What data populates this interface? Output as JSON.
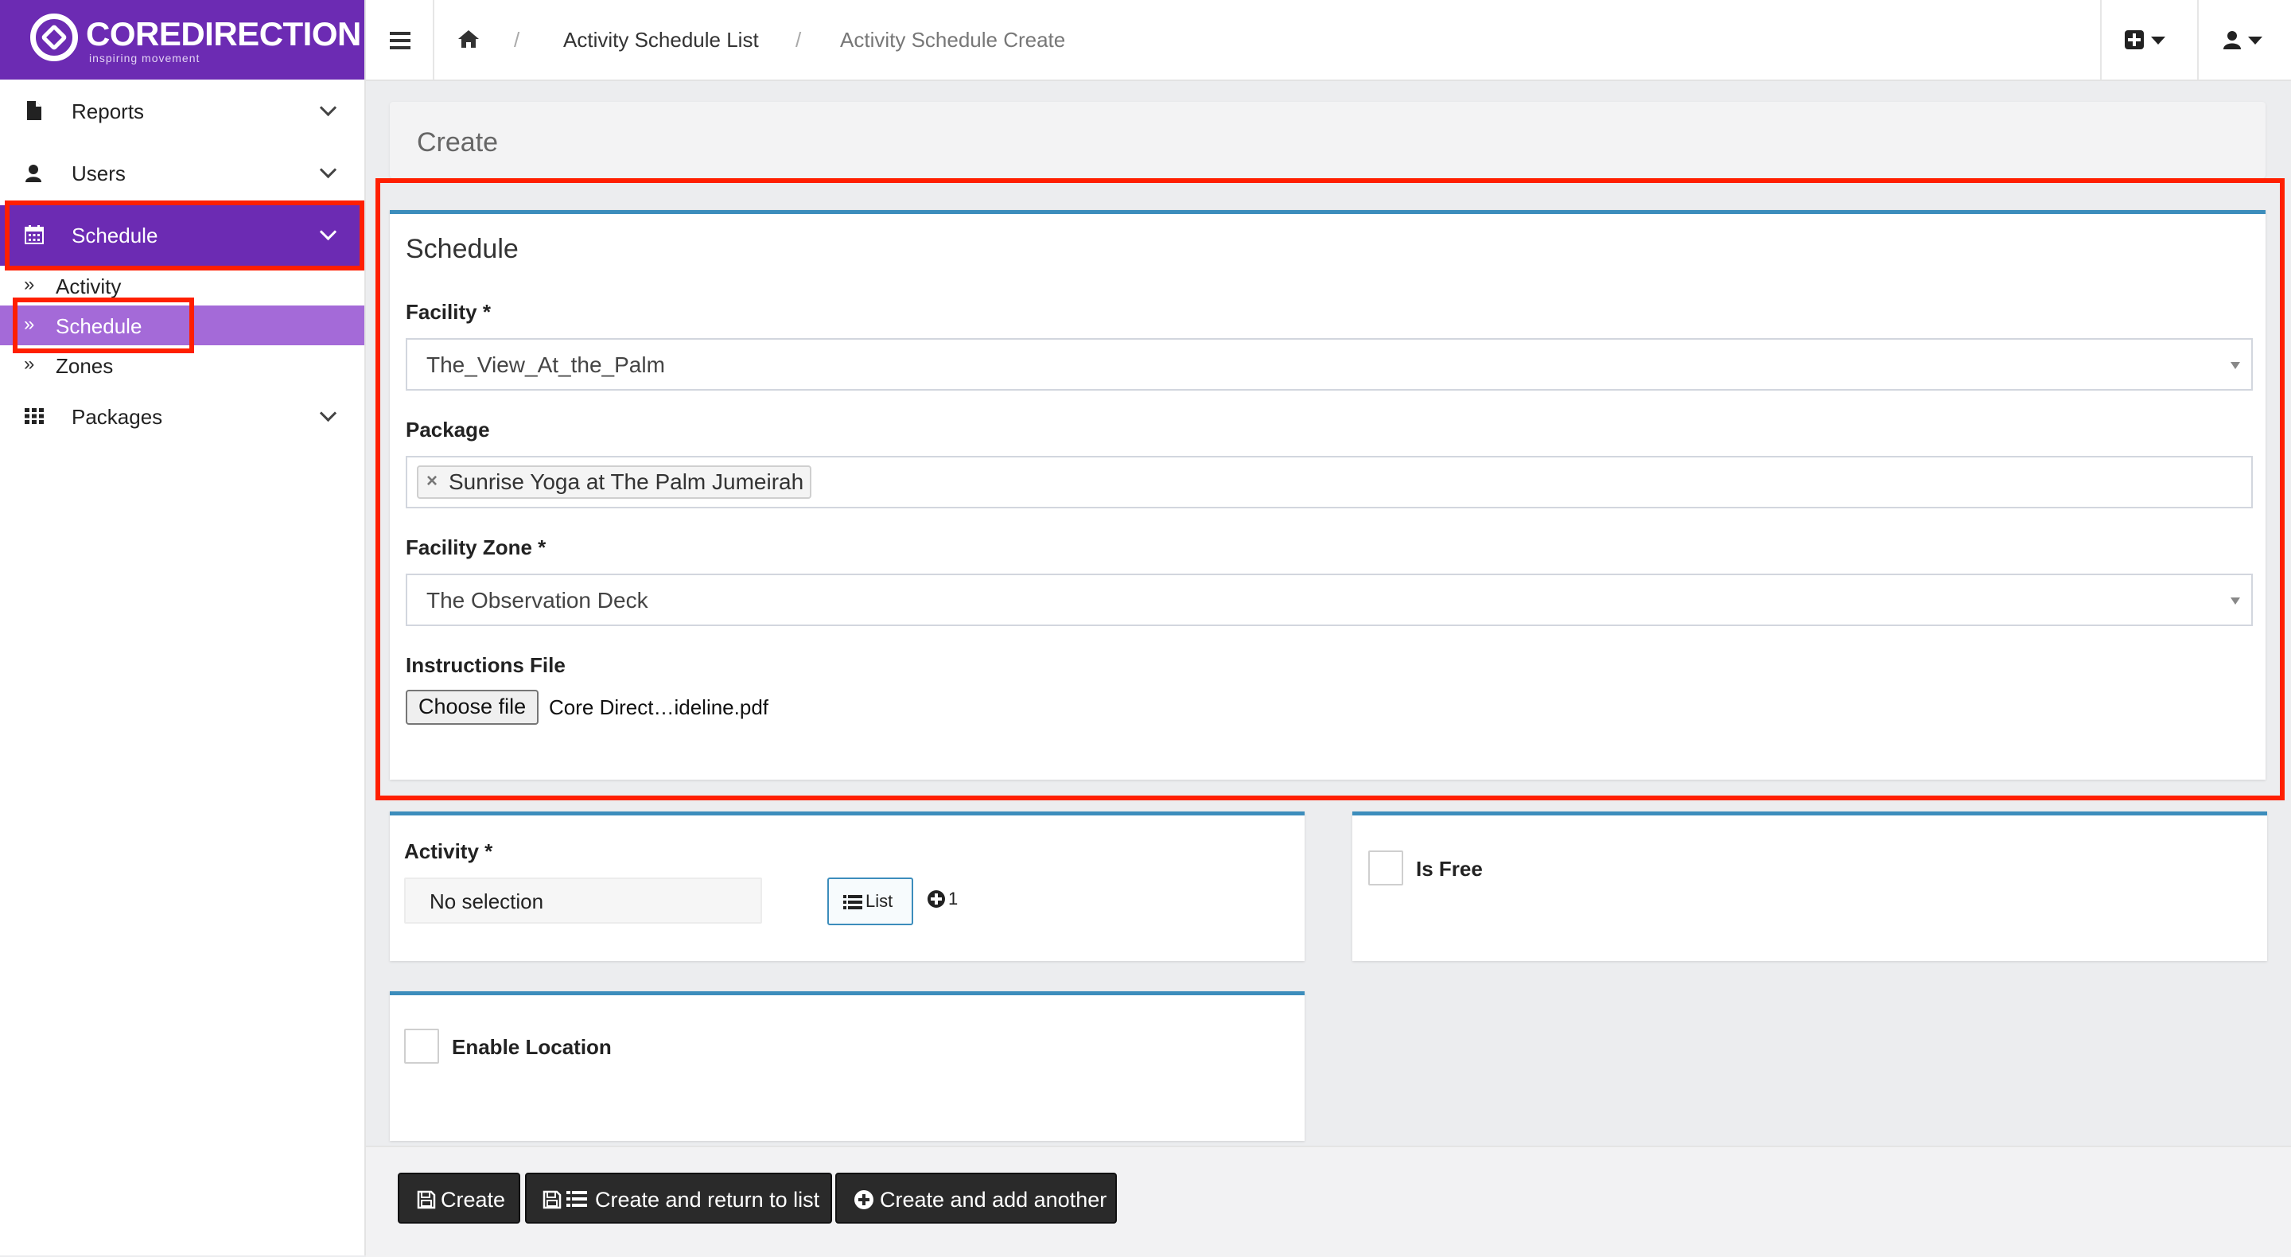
{
  "brand": {
    "name": "COREDIRECTION",
    "tagline": "inspiring movement",
    "color": "#6c2bb3"
  },
  "sidebar": {
    "items": [
      {
        "label": "Reports",
        "icon": "file-icon"
      },
      {
        "label": "Users",
        "icon": "user-icon"
      },
      {
        "label": "Schedule",
        "icon": "calendar-icon",
        "active": true
      },
      {
        "label": "Packages",
        "icon": "grid-icon"
      }
    ],
    "schedule_children": [
      {
        "label": "Activity"
      },
      {
        "label": "Schedule",
        "active": true
      },
      {
        "label": "Zones"
      }
    ]
  },
  "topbar": {
    "breadcrumb": [
      "Activity Schedule List",
      "Activity Schedule Create"
    ],
    "home_icon": "home-icon",
    "add_icon": "plus-square-icon",
    "user_icon": "user-icon"
  },
  "page": {
    "header_title": "Create"
  },
  "schedule_panel": {
    "title": "Schedule",
    "facility_label": "Facility *",
    "facility_value": "The_View_At_the_Palm",
    "package_label": "Package",
    "package_tags": [
      "Sunrise Yoga at The Palm Jumeirah"
    ],
    "zone_label": "Facility Zone *",
    "zone_value": "The Observation Deck",
    "file_label": "Instructions File",
    "file_button": "Choose file",
    "file_name": "Core Direct…ideline.pdf"
  },
  "activity_panel": {
    "label": "Activity *",
    "value": "No selection",
    "list_button": "List",
    "add_count": "1"
  },
  "is_free_panel": {
    "label": "Is Free",
    "checked": false
  },
  "location_panel": {
    "label": "Enable Location",
    "checked": false
  },
  "actions": {
    "create": "Create",
    "create_return": "Create and return to list",
    "create_another": "Create and add another"
  },
  "colors": {
    "accent_blue": "#3c8dbc",
    "highlight_red": "#ff1f00",
    "active_sub": "#a46ad8"
  }
}
